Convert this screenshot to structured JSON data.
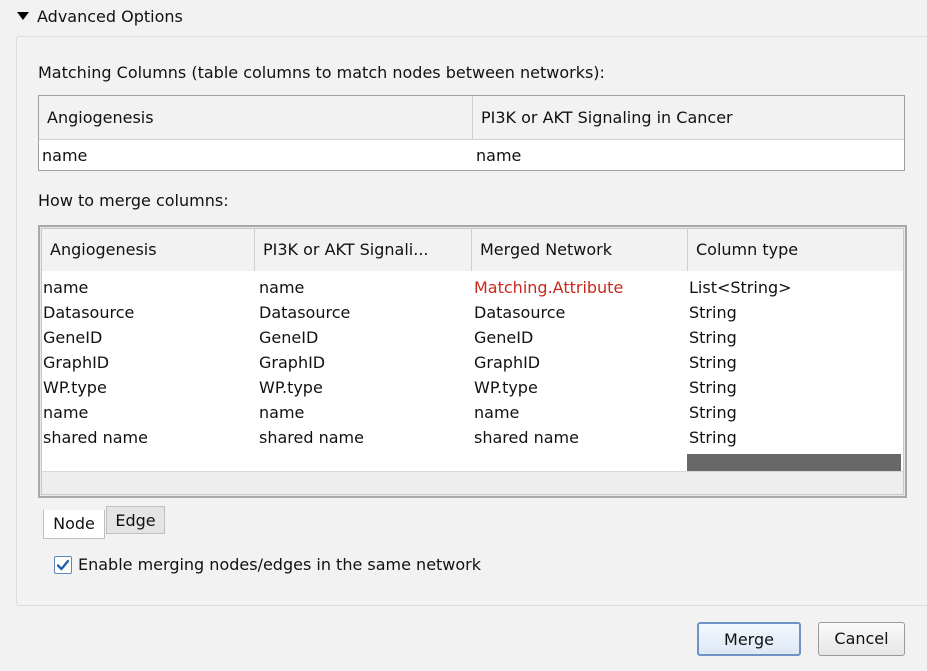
{
  "section": {
    "title": "Advanced Options",
    "icon": "triangle-down-icon"
  },
  "matching": {
    "label": "Matching Columns (table columns to match nodes between networks):",
    "headers": [
      "Angiogenesis",
      "PI3K or AKT Signaling in Cancer"
    ],
    "row": [
      "name",
      "name"
    ]
  },
  "merge": {
    "label": "How to merge columns:",
    "headers": [
      "Angiogenesis",
      "PI3K or AKT Signali...",
      "Merged Network",
      "Column type"
    ],
    "rows": [
      [
        "name",
        "name",
        "Matching.Attribute",
        "List<String>"
      ],
      [
        "Datasource",
        "Datasource",
        "Datasource",
        "String"
      ],
      [
        "GeneID",
        "GeneID",
        "GeneID",
        "String"
      ],
      [
        "GraphID",
        "GraphID",
        "GraphID",
        "String"
      ],
      [
        "WP.type",
        "WP.type",
        "WP.type",
        "String"
      ],
      [
        "name",
        "name",
        "name",
        "String"
      ],
      [
        "shared name",
        "shared name",
        "shared name",
        "String"
      ]
    ],
    "highlight_color": "#c8281e"
  },
  "tabs": {
    "node": "Node",
    "edge": "Edge",
    "active": "Node"
  },
  "option": {
    "label": "Enable merging nodes/edges in the same network",
    "checked": true
  },
  "buttons": {
    "merge": "Merge",
    "cancel": "Cancel"
  }
}
